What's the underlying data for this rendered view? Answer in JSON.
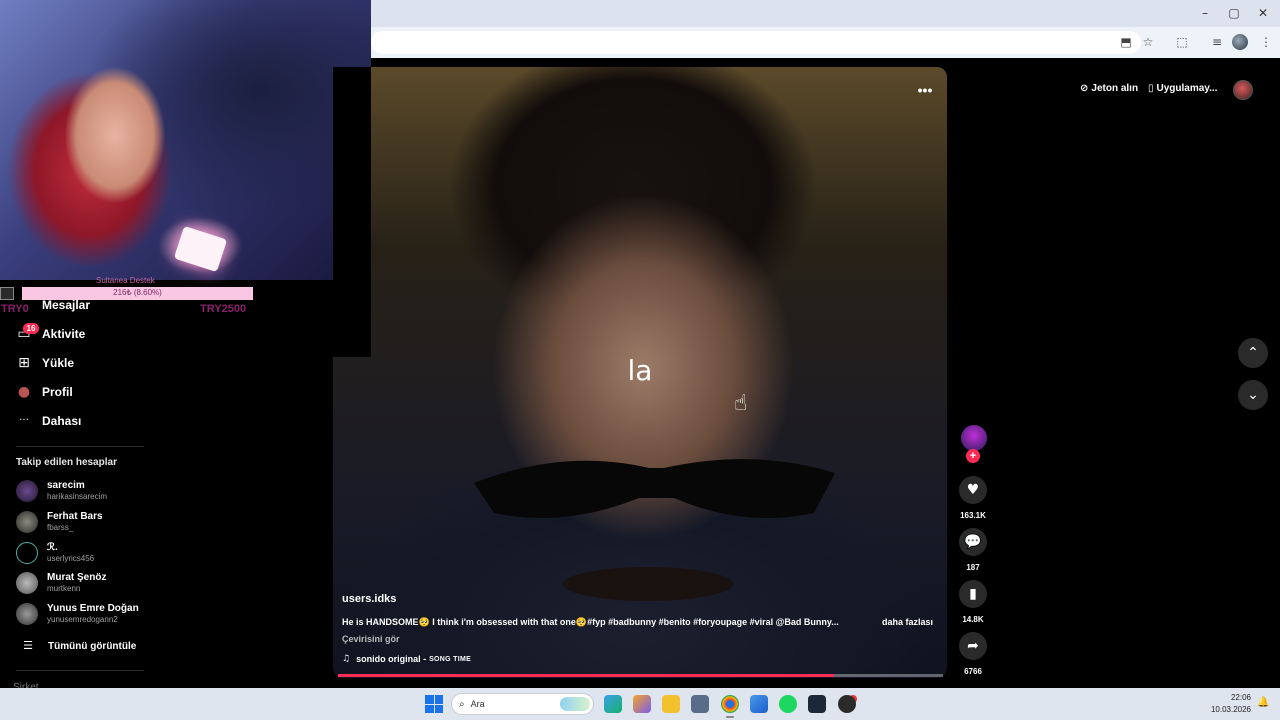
{
  "browser": {
    "window_controls": {
      "minimize": "–",
      "maximize": "▢",
      "close": "✕"
    },
    "toolbar_icons": {
      "install": "⬒",
      "bookmark": "☆",
      "extensions": "⬚",
      "tab_search": "≡",
      "menu": "⋮"
    }
  },
  "stream_overlay": {
    "donation_name": "Sultanea Destek",
    "donation_progress": "216₺ (8.60%)",
    "donation_percent": 8.6,
    "try_left": "TRY0",
    "try_right": "TRY2500"
  },
  "sidebar": {
    "nav": [
      {
        "label": "Mesajlar",
        "icon": "✉"
      },
      {
        "label": "Aktivite",
        "icon": "▭",
        "badge": "16"
      },
      {
        "label": "Yükle",
        "icon": "⊞"
      },
      {
        "label": "Profil",
        "icon": "●"
      },
      {
        "label": "Dahası",
        "icon": "···"
      }
    ],
    "following_title": "Takip edilen hesaplar",
    "following": [
      {
        "name": "sarecim",
        "handle": "harikasinsarecim"
      },
      {
        "name": "Ferhat Bars",
        "handle": "fbarss_"
      },
      {
        "name": "ℛ.",
        "handle": "userlyrics456"
      },
      {
        "name": "Murat Şenöz",
        "handle": "murtkenn"
      },
      {
        "name": "Yunus Emre Doğan",
        "handle": "yunusemredogann2"
      }
    ],
    "see_all": "Tümünü görüntüle",
    "company": "Şirket"
  },
  "video": {
    "overlay_text": "la",
    "username": "users.idks",
    "description": "He is HANDSOME🥺 I think i'm obsessed with that one🥺#fyp #badbunny #benito #foryoupage #viral @Bad Bunny...",
    "more": "daha fazlası",
    "translate": "Çevirisini gör",
    "music_title": "sonido original -",
    "music_song": "SONG TIME",
    "progress_percent": 82
  },
  "actions": {
    "likes": "163.1K",
    "comments": "187",
    "saves": "14.8K",
    "shares": "6766"
  },
  "header": {
    "coins": "Jeton alın",
    "app": "Uygulamay..."
  },
  "taskbar": {
    "search_placeholder": "Ara",
    "time": "22:06",
    "date": "10.03.2026"
  },
  "colors": {
    "accent": "#fe2c55",
    "taskbar": "#dfe5ef",
    "chrome": "#dde3ee"
  }
}
